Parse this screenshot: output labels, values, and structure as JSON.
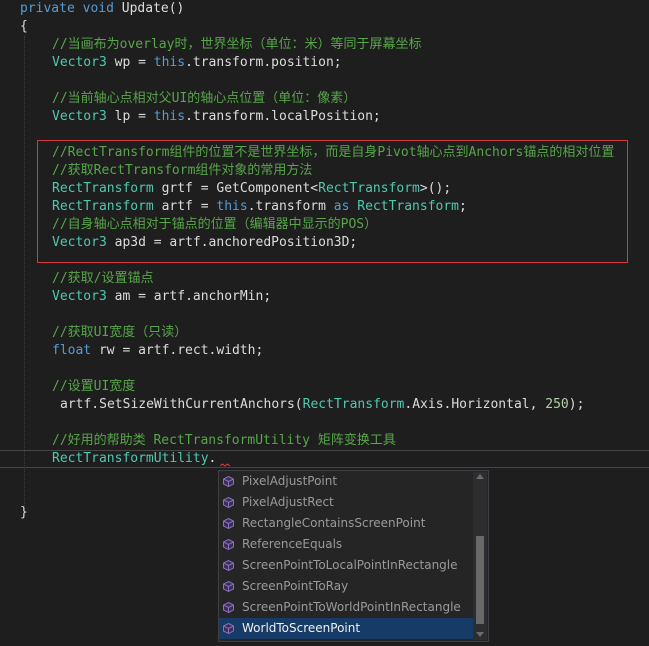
{
  "code": {
    "line1": {
      "kw1": "private",
      "kw2": "void",
      "name": "Update",
      "paren": "()"
    },
    "brace_open": "{",
    "line3": {
      "comment": "//当画布为overlay时，世界坐标（单位：米）等同于屏幕坐标"
    },
    "line4": {
      "type": "Vector3",
      "rest1": " wp = ",
      "kw": "this",
      "rest2": ".transform.position;"
    },
    "line6": {
      "comment": "//当前轴心点相对父UI的轴心点位置（单位：像素）"
    },
    "line7": {
      "type": "Vector3",
      "rest1": " lp = ",
      "kw": "this",
      "rest2": ".transform.localPosition;"
    },
    "line9": {
      "comment": "//RectTransform组件的位置不是世界坐标，而是自身Pivot轴心点到Anchors锚点的相对位置"
    },
    "line10": {
      "comment": "//获取RectTransform组件对象的常用方法"
    },
    "line11": {
      "type": "RectTransform",
      "rest1": " grtf = GetComponent<",
      "type2": "RectTransform",
      "rest2": ">();"
    },
    "line12": {
      "type": "RectTransform",
      "rest1": " artf = ",
      "kw": "this",
      "rest2": ".transform ",
      "kw2": "as",
      "space": " ",
      "type2": "RectTransform",
      "semi": ";"
    },
    "line13": {
      "comment": "//自身轴心点相对于锚点的位置（编辑器中显示的POS）"
    },
    "line14": {
      "type": "Vector3",
      "rest1": " ap3d = artf.anchoredPosition3D;"
    },
    "line16": {
      "comment": "//获取/设置锚点"
    },
    "line17": {
      "type": "Vector3",
      "rest1": " am = artf.anchorMin;"
    },
    "line19": {
      "comment": "//获取UI宽度（只读）"
    },
    "line20": {
      "kw": "float",
      "rest1": " rw = artf.rect.width;"
    },
    "line22": {
      "comment": "//设置UI宽度"
    },
    "line23": {
      "rest1": "artf.SetSizeWithCurrentAnchors(",
      "type": "RectTransform",
      "rest2": ".Axis.Horizontal, ",
      "num": "250",
      "rest3": ");"
    },
    "line25": {
      "comment": "//好用的帮助类 RectTransformUtility 矩阵变换工具"
    },
    "line26": {
      "type": "RectTransformUtility",
      "rest1": "."
    },
    "brace_close": "}"
  },
  "autocomplete": {
    "items": [
      {
        "label": "PixelAdjustPoint",
        "icon": "method-cube-icon"
      },
      {
        "label": "PixelAdjustRect",
        "icon": "method-cube-icon"
      },
      {
        "label": "RectangleContainsScreenPoint",
        "icon": "method-cube-icon"
      },
      {
        "label": "ReferenceEquals",
        "icon": "method-cube-icon"
      },
      {
        "label": "ScreenPointToLocalPointInRectangle",
        "icon": "method-cube-icon"
      },
      {
        "label": "ScreenPointToRay",
        "icon": "method-cube-icon"
      },
      {
        "label": "ScreenPointToWorldPointInRectangle",
        "icon": "method-cube-icon"
      },
      {
        "label": "WorldToScreenPoint",
        "icon": "method-cube-icon"
      }
    ],
    "selected_index": 7
  },
  "colors": {
    "keyword": "#569cd6",
    "type": "#4ec9b0",
    "comment": "#57a64a",
    "text": "#dcdcdc",
    "number": "#b5cea8",
    "highlight_box": "#d13b3b",
    "selection": "#163b66",
    "background": "#1e1e1e"
  }
}
